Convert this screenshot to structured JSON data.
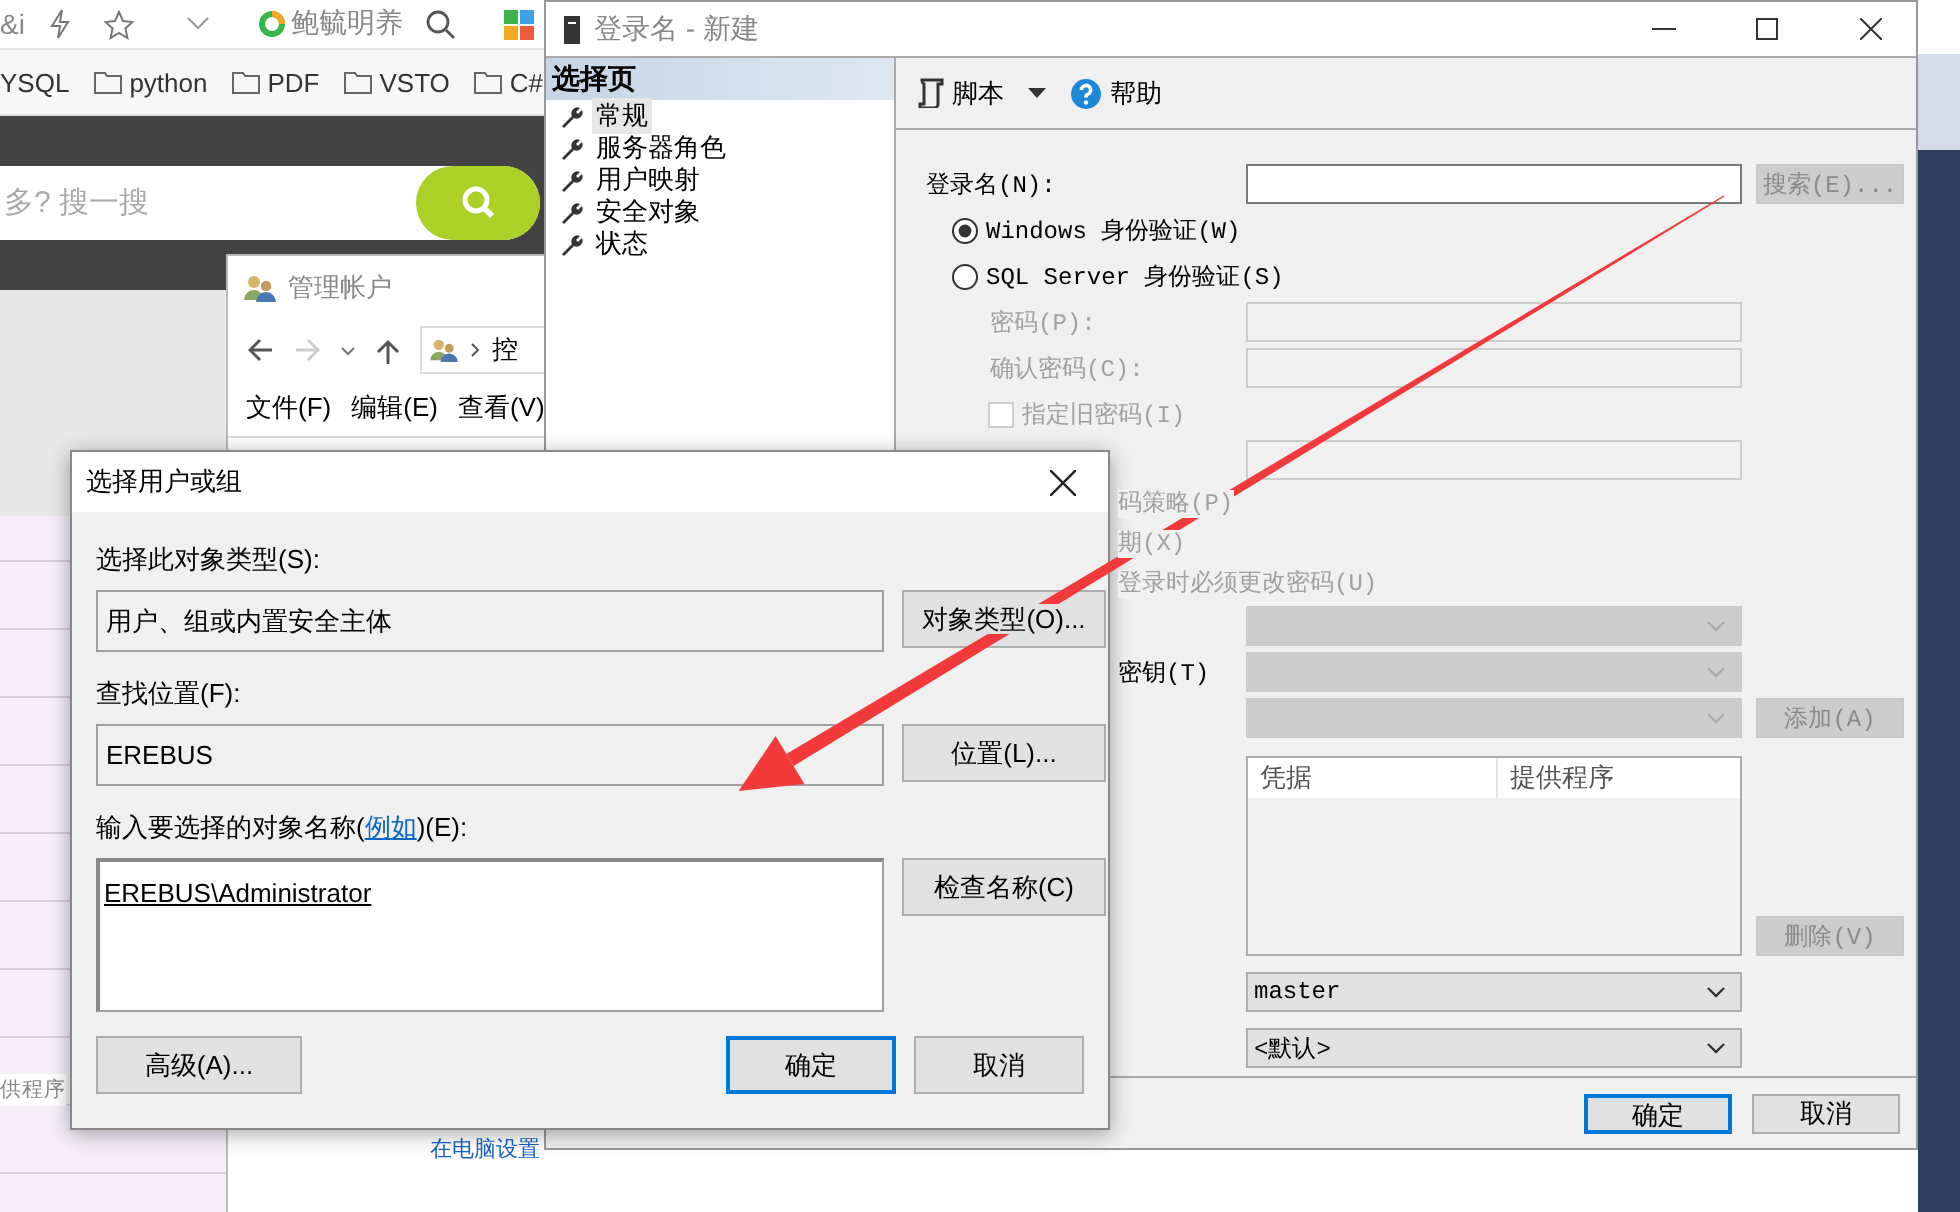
{
  "browser": {
    "tab_text": "&i",
    "site_name": "鲍毓明养",
    "bookmarks": [
      {
        "label": "YSQL",
        "folder": false
      },
      {
        "label": "python",
        "folder": true
      },
      {
        "label": "PDF",
        "folder": true
      },
      {
        "label": "VSTO",
        "folder": true
      },
      {
        "label": "C#",
        "folder": true
      }
    ],
    "search": {
      "placeholder": "多? 搜一搜"
    },
    "side_text": "供程序"
  },
  "explorer": {
    "title": "管理帐户",
    "breadcrumb": "控",
    "menu": [
      "文件(F)",
      "编辑(E)",
      "查看(V)"
    ],
    "link": "在电脑设置"
  },
  "login_window": {
    "title": "登录名 - 新建",
    "sidebar": {
      "header": "选择页",
      "items": [
        {
          "label": "常规",
          "selected": true
        },
        {
          "label": "服务器角色",
          "selected": false
        },
        {
          "label": "用户映射",
          "selected": false
        },
        {
          "label": "安全对象",
          "selected": false
        },
        {
          "label": "状态",
          "selected": false
        }
      ]
    },
    "toolbar": [
      {
        "kind": "script",
        "label": "脚本"
      },
      {
        "kind": "help",
        "label": "帮助"
      }
    ],
    "form": [
      {
        "kind": "text",
        "label": "登录名(N):",
        "disabled": false,
        "button": {
          "label": "搜索(E)...",
          "disabled": true
        }
      },
      {
        "kind": "radio",
        "label": "Windows 身份验证(W)",
        "selected": true
      },
      {
        "kind": "radio",
        "label": "SQL Server 身份验证(S)",
        "selected": false,
        "children": [
          {
            "kind": "text",
            "label": "密码(P):",
            "disabled": true
          },
          {
            "kind": "text",
            "label": "确认密码(C):",
            "disabled": true
          },
          {
            "kind": "checkbox",
            "label": "指定旧密码(I)",
            "checked": false,
            "disabled": true
          },
          {
            "kind": "text",
            "disabled": true
          },
          {
            "kind": "fragment",
            "label": "码策略(P)",
            "disabled": true
          },
          {
            "kind": "fragment",
            "label": "期(X)",
            "disabled": true
          },
          {
            "kind": "fragment",
            "label": "登录时必须更改密码(U)",
            "disabled": true
          }
        ]
      },
      {
        "kind": "combo",
        "disabled": true
      },
      {
        "kind": "combo",
        "label": "密钥(T)",
        "disabled": true
      },
      {
        "kind": "combo",
        "disabled": true,
        "button": {
          "label": "添加(A)",
          "disabled": true
        }
      },
      {
        "kind": "list",
        "columns": [
          "凭据",
          "提供程序"
        ],
        "button": {
          "label": "删除(V)",
          "disabled": true
        }
      },
      {
        "kind": "combo",
        "value": "master",
        "disabled": false
      },
      {
        "kind": "combo",
        "value": "<默认>",
        "disabled": false
      }
    ],
    "buttons": [
      {
        "label": "确定",
        "default": true
      },
      {
        "label": "取消",
        "default": false
      }
    ]
  },
  "dialog": {
    "title": "选择用户或组",
    "sections": [
      {
        "label": "选择此对象类型(S):",
        "value": "用户、组或内置安全主体",
        "multiline": false,
        "button": "对象类型(O)..."
      },
      {
        "label": "查找位置(F):",
        "value": "EREBUS",
        "multiline": false,
        "button": "位置(L)..."
      },
      {
        "label": "输入要选择的对象名称(",
        "link": "例如",
        "label_end": ")(E):",
        "value": "EREBUS\\Administrator",
        "multiline": true,
        "button": "检查名称(C)"
      }
    ],
    "buttons": [
      {
        "label": "高级(A)...",
        "default": false
      },
      {
        "label": "确定",
        "default": true
      },
      {
        "label": "取消",
        "default": false
      }
    ]
  }
}
